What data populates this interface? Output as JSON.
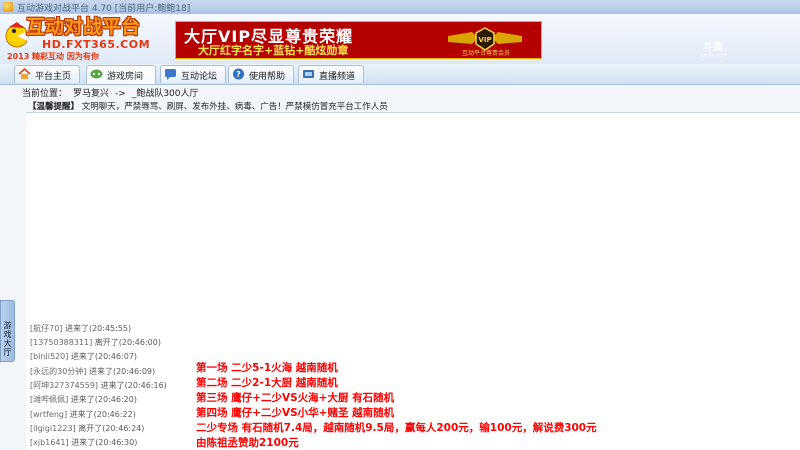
{
  "window": {
    "title": "互动游戏对战平台 4.70 [当前用户:鲍鲍18]"
  },
  "logo": {
    "main": "互动对战平台",
    "url": "HD.FXT365.COM",
    "slogan": "2013 精彩互动 因为有你"
  },
  "vip_banner": {
    "line1": "大厅VIP尽显尊贵荣耀",
    "line2": "大厅红字名字+蓝钻+酷炫勋章",
    "badge_caption": "互动平台尊贵会员"
  },
  "watermark": {
    "brand": "斗鱼",
    "url": "douyu.com"
  },
  "nav": {
    "tabs": [
      {
        "label": "平台主页",
        "icon": "home-icon"
      },
      {
        "label": "游戏房间",
        "icon": "game-room-icon"
      },
      {
        "label": "互动论坛",
        "icon": "forum-icon"
      },
      {
        "label": "使用帮助",
        "icon": "help-icon"
      },
      {
        "label": "直播频道",
        "icon": "live-channel-icon"
      }
    ],
    "active_index": 1
  },
  "location": {
    "prefix": "当前位置：",
    "path": [
      "罗马复兴",
      "->",
      "_鲍战队300人厅"
    ]
  },
  "notice": {
    "label": "【温馨提醒】",
    "text": "文明聊天，严禁辱骂、刷屏、发布外挂、病毒、广告！严禁模仿冒充平台工作人员"
  },
  "side_tab": {
    "label": "游戏大厅"
  },
  "log": [
    {
      "user": "[航仔70]",
      "action": "进来了",
      "time": "(20:45:55)"
    },
    {
      "user": "[13750388311]",
      "action": "离开了",
      "time": "(20:46:00)"
    },
    {
      "user": "[binli520]",
      "action": "进来了",
      "time": "(20:46:07)"
    },
    {
      "user": "[永远的30分钟]",
      "action": "进来了",
      "time": "(20:46:09)"
    },
    {
      "user": "[阿坤327374559]",
      "action": "进来了",
      "time": "(20:46:16)"
    },
    {
      "user": "[滩哔佩佩]",
      "action": "进来了",
      "time": "(20:46:20)"
    },
    {
      "user": "[wrtfeng]",
      "action": "进来了",
      "time": "(20:46:22)"
    },
    {
      "user": "[ilgigi1223]",
      "action": "离开了",
      "time": "(20:46:24)"
    },
    {
      "user": "[xjb1641]",
      "action": "进来了",
      "time": "(20:46:30)"
    }
  ],
  "schedule": [
    "第一场  二少5-1火海  越南随机",
    "第二场  二少2-1大厨  越南随机",
    "第三场  鹰仔+二少VS火海+大厨  有石随机",
    "第四场  鹰仔+二少VS小华+赌圣  越南随机",
    "二少专场 有石随机7.4局，越南随机9.5局，赢每人200元，输100元，解说费300元",
    "由陈祖丞赞助2100元"
  ],
  "colors": {
    "schedule_text": "#ff0000",
    "banner_red": "#b40000",
    "logo_orange": "#ff9d19"
  }
}
